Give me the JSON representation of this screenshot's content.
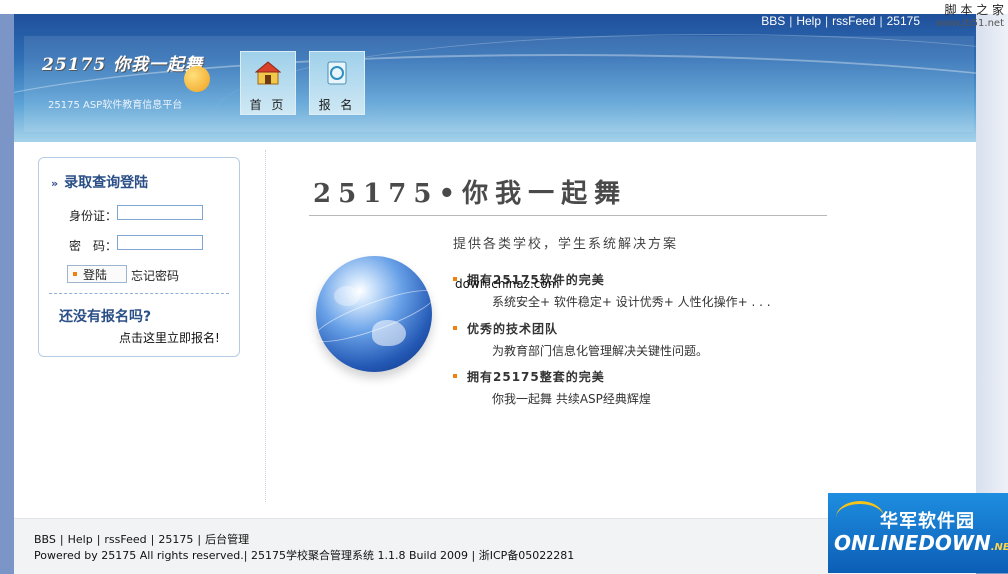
{
  "header": {
    "top_links": [
      "BBS",
      "Help",
      "rssFeed",
      "25175"
    ],
    "logo_title": "25175 你我一起舞",
    "logo_subtitle": "25175 ASP软件教育信息平台",
    "nav": [
      {
        "label": "首 页",
        "icon": "home-icon"
      },
      {
        "label": "报 名",
        "icon": "form-icon"
      }
    ],
    "watermark_line1": "脚 本 之 家",
    "watermark_line2": "www.Jb51.net"
  },
  "sidebar": {
    "title": "录取查询登陆",
    "id_label": "身份证：",
    "id_value": "",
    "password_label": "密　码：",
    "password_value": "",
    "login_label": "登陆",
    "forgot_label": "忘记密码",
    "not_registered": "还没有报名吗?",
    "register_link": "点击这里立即报名!"
  },
  "main": {
    "title": "25175•你我一起舞",
    "subtitle": "提供各类学校，学生系统解决方案",
    "overlay_url": "down.chinaz.com",
    "features": [
      {
        "heading": "拥有25175软件的完美",
        "desc": "系统安全+ 软件稳定+ 设计优秀+ 人性化操作+ . . ."
      },
      {
        "heading": "优秀的技术团队",
        "desc": "为教育部门信息化管理解决关键性问题。"
      },
      {
        "heading": "拥有25175整套的完美",
        "desc": "你我一起舞 共续ASP经典辉煌"
      }
    ]
  },
  "footer": {
    "links": [
      "BBS",
      "Help",
      "rssFeed",
      "25175",
      "后台管理"
    ],
    "copyright": "Powered by 25175 All rights reserved.| 25175学校聚合管理系统 1.1.8 Build 2009 | 浙ICP备05022281"
  },
  "badge": {
    "cn": "华军软件园",
    "en": "ONLINEDOWN",
    "suffix": ".NET"
  },
  "colors": {
    "accent": "#f08010",
    "header_dark": "#1f4f9a",
    "heading_blue": "#2a4f86"
  }
}
